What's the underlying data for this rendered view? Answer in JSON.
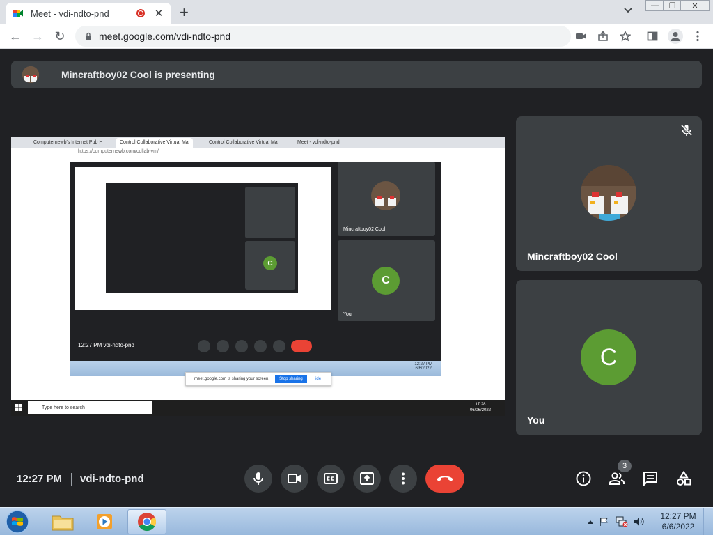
{
  "browser": {
    "tab_title": "Meet - vdi-ndto-pnd",
    "tab_close": "✕",
    "new_tab": "+",
    "tab_dropdown": "⌄",
    "url": "meet.google.com/vdi-ndto-pnd",
    "window_controls": {
      "minimize": "—",
      "restore": "❐",
      "close": "✕"
    },
    "nav": {
      "back": "←",
      "forward": "→",
      "reload": "↻"
    }
  },
  "banner": {
    "text": "Mincraftboy02 Cool is presenting"
  },
  "shared_screen": {
    "tabs": [
      "Computernewb's Internet Pub H",
      "Control Collaborative Virtual Ma",
      "Control Collaborative Virtual Ma",
      "Meet - vdi-ndto-pnd"
    ],
    "url": "https://computernewb.com/collab-vm/",
    "inner_tile_name": "Mincraftboy02 Cool",
    "inner_tile_you": "You",
    "inner_c": "C",
    "inner_time": "12:27 PM   vdi-ndto-pnd",
    "inner_clock": "12:27 PM\n6/6/2022",
    "share_notice": "meet.google.com is sharing your screen.",
    "stop_sharing": "Stop sharing",
    "hide": "Hide",
    "taskbar_search": "Type here to search",
    "taskbar_clock": "17:28\n06/06/2022"
  },
  "tiles": {
    "presenter_name": "Mincraftboy02 Cool",
    "you_name": "You",
    "you_initial": "C"
  },
  "bottom_bar": {
    "time": "12:27 PM",
    "meeting_code": "vdi-ndto-pnd",
    "participants_count": "3"
  },
  "taskbar": {
    "clock_time": "12:27 PM",
    "clock_date": "6/6/2022"
  },
  "colors": {
    "meet_background": "#202124",
    "tile": "#3c4043",
    "hangup": "#ea4335",
    "avatar_c": "#5c9c33"
  }
}
